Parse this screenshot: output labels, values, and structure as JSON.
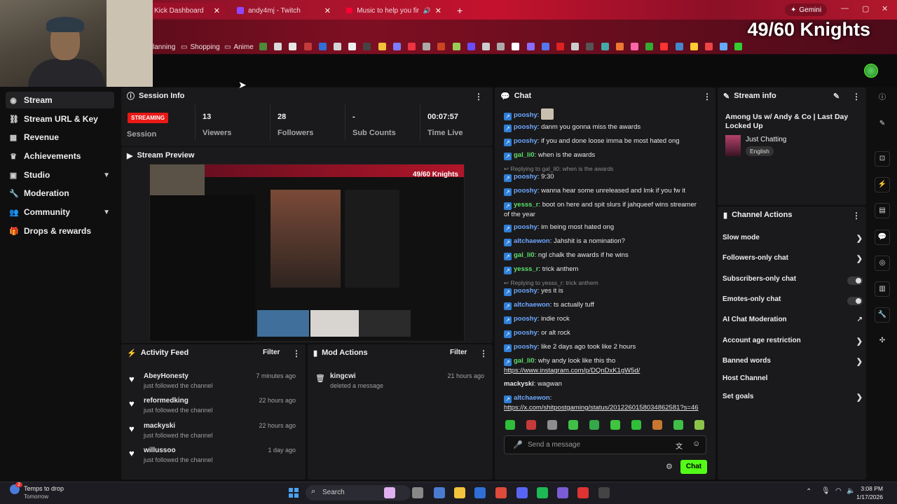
{
  "browser": {
    "tabs": [
      {
        "title": "Kick Dashboard"
      },
      {
        "title": "andy4mj - Twitch"
      },
      {
        "title": "Music to help you find your"
      }
    ],
    "new_tab": "+",
    "gemini": "Gemini",
    "bookmarks": [
      "lanning",
      "Shopping",
      "Anime"
    ]
  },
  "overlay": {
    "knights": "49/60 Knights"
  },
  "nav": {
    "items": [
      {
        "label": "Stream",
        "icon": "stream-icon"
      },
      {
        "label": "Stream URL & Key",
        "icon": "link-icon"
      },
      {
        "label": "Revenue",
        "icon": "revenue-icon"
      },
      {
        "label": "Achievements",
        "icon": "trophy-icon"
      },
      {
        "label": "Studio",
        "icon": "studio-icon"
      },
      {
        "label": "Moderation",
        "icon": "wrench-icon"
      },
      {
        "label": "Community",
        "icon": "people-icon"
      },
      {
        "label": "Drops & rewards",
        "icon": "gift-icon"
      }
    ]
  },
  "session": {
    "title": "Session Info",
    "badge": "STREAMING",
    "session_label": "Session",
    "stats": [
      {
        "value": "13",
        "label": "Viewers"
      },
      {
        "value": "28",
        "label": "Followers"
      },
      {
        "value": "-",
        "label": "Sub Counts"
      },
      {
        "value": "00:07:57",
        "label": "Time Live"
      }
    ]
  },
  "preview": {
    "title": "Stream Preview",
    "overlay_text": "49/60 Knights"
  },
  "activity": {
    "title": "Activity Feed",
    "filter": "Filter",
    "rows": [
      {
        "name": "AbeyHonesty",
        "sub": "just followed the channel",
        "time": "7 minutes ago"
      },
      {
        "name": "reformedking",
        "sub": "just followed the channel",
        "time": "22 hours ago"
      },
      {
        "name": "mackyski",
        "sub": "just followed the channel",
        "time": "22 hours ago"
      },
      {
        "name": "willussoo",
        "sub": "just followed the channel",
        "time": "1 day ago"
      }
    ]
  },
  "mod": {
    "title": "Mod Actions",
    "filter": "Filter",
    "rows": [
      {
        "name": "kingcwi",
        "sub": "deleted a message",
        "time": "21 hours ago"
      }
    ]
  },
  "chat": {
    "title": "Chat",
    "messages": [
      {
        "user": "pooshy",
        "text": ""
      },
      {
        "user": "pooshy",
        "text": "danm you gonna miss the awards"
      },
      {
        "user": "pooshy",
        "text": "if you and done loose imma be most hated ong"
      },
      {
        "user": "gal_li0",
        "text": "when is the awards"
      },
      {
        "user": "pooshy",
        "text": "9:30"
      },
      {
        "user": "pooshy",
        "text": "wanna hear some unreleased and lmk if you fw it"
      },
      {
        "user": "yesss_r",
        "text": "boot on here and spit slurs if jahqueef wins streamer of the year"
      },
      {
        "user": "pooshy",
        "text": "im being most hated ong"
      },
      {
        "user": "altchaewon",
        "text": "Jahshit is a nomination?"
      },
      {
        "user": "gal_li0",
        "text": "ngl chalk the awards if he wins"
      },
      {
        "user": "yesss_r",
        "text": "trick anthem"
      },
      {
        "user": "pooshy",
        "text": "yes it is"
      },
      {
        "user": "altchaewon",
        "text": "ts actually tuff"
      },
      {
        "user": "pooshy",
        "text": "indie rock"
      },
      {
        "user": "pooshy",
        "text": "or alt rock"
      },
      {
        "user": "pooshy",
        "text": "like 2 days ago took like 2 hours"
      },
      {
        "user": "gal_li0",
        "text": "why andy look like this tho"
      },
      {
        "user": "mackyski",
        "text": "wagwan"
      },
      {
        "user": "altchaewon",
        "text": ""
      }
    ],
    "replies": [
      "Replying to gal_li0: when is the awards",
      "Replying to yesss_r: trick anthem"
    ],
    "links": [
      "https://www.instagram.com/p/DQnDxK1gW5d/",
      "https://x.com/shitpostgaming/status/2012260158034862581?s=46"
    ],
    "placeholder": "Send a message",
    "send": "Chat"
  },
  "stream_info": {
    "title": "Stream info",
    "stream_title": "Among Us w/ Andy & Co | Last Day Locked Up",
    "category": "Just Chatting",
    "language": "English"
  },
  "channel_actions": {
    "title": "Channel Actions",
    "items": [
      {
        "label": "Slow mode"
      },
      {
        "label": "Followers-only chat"
      },
      {
        "label": "Subscribers-only chat"
      },
      {
        "label": "Emotes-only chat"
      },
      {
        "label": "AI Chat Moderation"
      },
      {
        "label": "Account age restriction"
      },
      {
        "label": "Banned words"
      },
      {
        "label": "Host Channel"
      },
      {
        "label": "Set goals"
      }
    ]
  },
  "taskbar": {
    "weather_title": "Temps to drop",
    "weather_sub": "Tomorrow",
    "search": "Search",
    "time": "3:08 PM",
    "date": "1/17/2026",
    "badge": "2"
  }
}
